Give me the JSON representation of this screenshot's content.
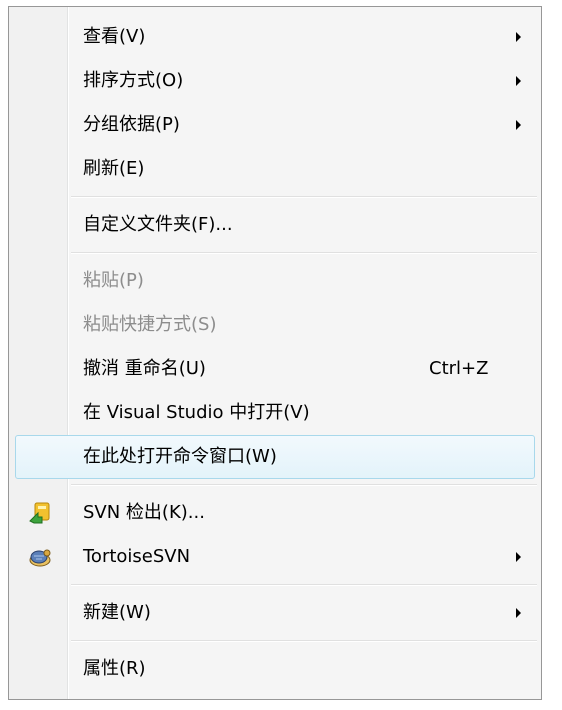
{
  "menu": {
    "view_label": "查看(V)",
    "sort_label": "排序方式(O)",
    "group_label": "分组依据(P)",
    "refresh_label": "刷新(E)",
    "customize_label": "自定义文件夹(F)...",
    "paste_label": "粘贴(P)",
    "paste_shortcut_label": "粘贴快捷方式(S)",
    "undo_rename_label": "撤消 重命名(U)",
    "undo_rename_shortcut": "Ctrl+Z",
    "open_vs_label": "在 Visual Studio 中打开(V)",
    "open_cmd_label": "在此处打开命令窗口(W)",
    "svn_checkout_label": "SVN 检出(K)...",
    "tortoisesvn_label": "TortoiseSVN",
    "new_label": "新建(W)",
    "properties_label": "属性(R)"
  },
  "colors": {
    "hover_border": "#a8d8eb",
    "disabled_text": "#8d8d8d"
  },
  "icons": {
    "svn_checkout": "svn-checkout-icon",
    "tortoisesvn": "tortoisesvn-icon"
  }
}
